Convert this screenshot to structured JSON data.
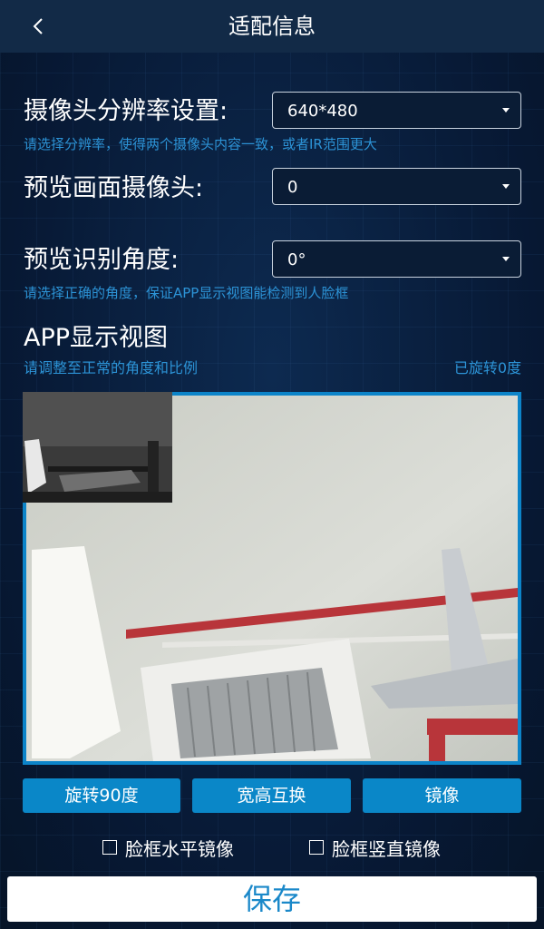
{
  "header": {
    "title": "适配信息",
    "back_icon": "chevron-left-icon"
  },
  "resolution": {
    "label": "摄像头分辨率设置:",
    "value": "640*480",
    "hint": "请选择分辨率，使得两个摄像头内容一致，或者IR范围更大"
  },
  "preview_camera": {
    "label": "预览画面摄像头:",
    "value": "0"
  },
  "preview_angle": {
    "label": "预览识别角度:",
    "value": "0°",
    "hint": "请选择正确的角度，保证APP显示视图能检测到人脸框"
  },
  "app_view": {
    "title": "APP显示视图",
    "hint": "请调整至正常的角度和比例",
    "rotation_status": "已旋转0度"
  },
  "actions": {
    "rotate_label": "旋转90度",
    "swap_label": "宽高互换",
    "mirror_label": "镜像"
  },
  "checkboxes": {
    "horizontal_label": "脸框水平镜像",
    "horizontal_checked": false,
    "vertical_label": "脸框竖直镜像",
    "vertical_checked": false
  },
  "save_label": "保存",
  "colors": {
    "background": "#081a33",
    "header": "#122a47",
    "accent": "#0a87c8",
    "hint_text": "#2c93d6"
  }
}
